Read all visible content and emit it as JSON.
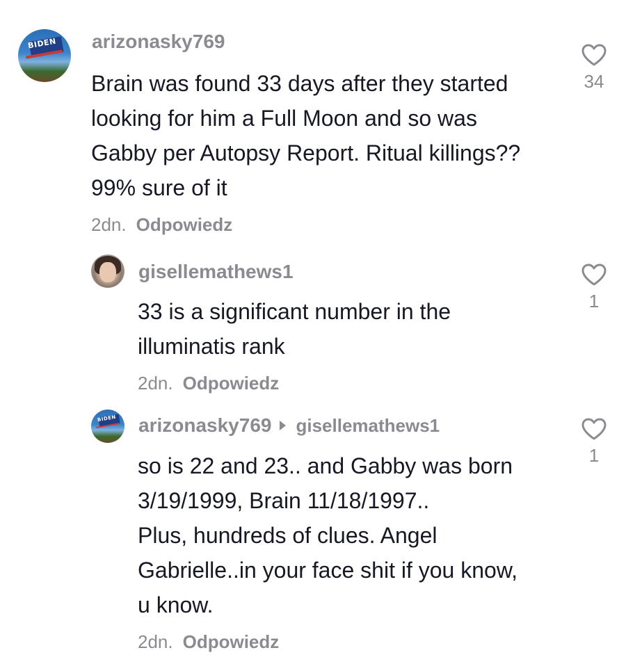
{
  "comments": [
    {
      "username": "arizonasky769",
      "avatar_label": "BIDEN",
      "lines": [
        "Brain was found 33 days after they started",
        "looking for him a Full Moon and so was",
        "Gabby per Autopsy Report. Ritual killings??",
        "99% sure of it"
      ],
      "time": "2dn.",
      "reply_label": "Odpowiedz",
      "likes": "34"
    },
    {
      "username": "gisellemathews1",
      "lines": [
        "33 is a significant number in the",
        "illuminatis rank"
      ],
      "time": "2dn.",
      "reply_label": "Odpowiedz",
      "likes": "1"
    },
    {
      "username": "arizonasky769",
      "reply_to": "gisellemathews1",
      "avatar_label": "BIDEN",
      "lines": [
        "so is 22 and 23.. and Gabby was born",
        "3/19/1999, Brain 11/18/1997..",
        "Plus, hundreds of clues. Angel",
        "Gabrielle..in your face shit if you know,",
        "u know."
      ],
      "time": "2dn.",
      "reply_label": "Odpowiedz",
      "likes": "1"
    }
  ],
  "icons": {
    "like": "heart-outline-icon",
    "reply_arrow": "triangle-right-icon"
  },
  "colors": {
    "text": "#161823",
    "muted": "#8a8b91",
    "background": "#ffffff"
  }
}
